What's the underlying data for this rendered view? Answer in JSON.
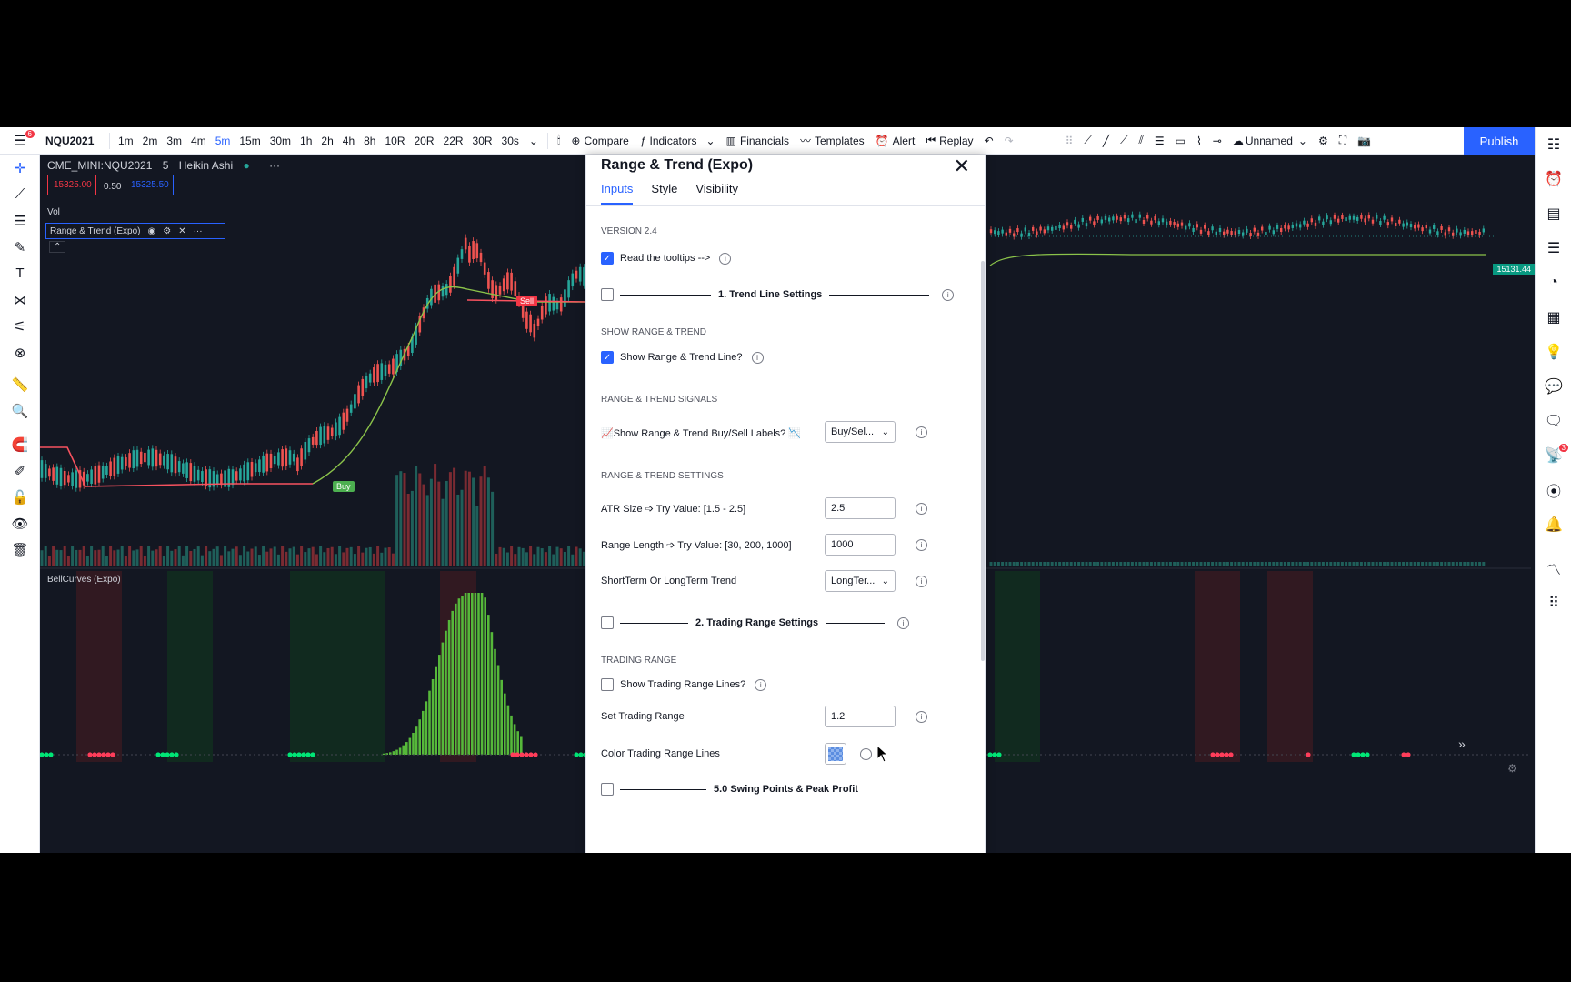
{
  "topbar": {
    "menu_badge": "6",
    "symbol": "NQU2021",
    "timeframes": [
      "1m",
      "2m",
      "3m",
      "4m",
      "5m",
      "15m",
      "30m",
      "1h",
      "2h",
      "4h",
      "8h",
      "10R",
      "20R",
      "22R",
      "30R",
      "30s"
    ],
    "active_timeframe": "5m",
    "compare": "Compare",
    "indicators": "Indicators",
    "financials": "Financials",
    "templates": "Templates",
    "alert": "Alert",
    "replay": "Replay",
    "layout_name": "Unnamed",
    "publish": "Publish"
  },
  "chart": {
    "symbol_line": "CME_MINI:NQU2021",
    "interval": "5",
    "chart_type": "Heikin Ashi",
    "bid": "15325.00",
    "spread": "0.50",
    "ask": "15325.50",
    "vol_label": "Vol",
    "indicator_name": "Range & Trend (Expo)",
    "lower_pane_name": "BellCurves (Expo)",
    "price_tag": "15131.44",
    "sell_label": "Sell",
    "buy_label": "Buy",
    "colors": {
      "up": "#26a69a",
      "down": "#ef5350",
      "trend": "#8bc34a",
      "range": "#f7525f",
      "accent": "#2962ff"
    }
  },
  "rightbar": {
    "notification_count": "3"
  },
  "dialog": {
    "title": "Range & Trend (Expo)",
    "tabs": [
      "Inputs",
      "Style",
      "Visibility"
    ],
    "version": "VERSION 2.4",
    "read_tooltips": "Read the tooltips -->",
    "trend_header": "1. Trend Line Settings",
    "show_range_trend_section": "SHOW RANGE & TREND",
    "show_range_trend_line": "Show Range & Trend Line?",
    "signals_section": "RANGE & TREND SIGNALS",
    "show_labels": "📈Show Range & Trend Buy/Sell Labels? 📉",
    "labels_value": "Buy/Sel...",
    "settings_section": "RANGE & TREND SETTINGS",
    "atr_label": "ATR Size ➩ Try Value: [1.5 - 2.5]",
    "atr_value": "2.5",
    "range_length_label": "Range Length ➩ Try Value: [30, 200, 1000]",
    "range_length_value": "1000",
    "trend_mode_label": "ShortTerm Or LongTerm Trend",
    "trend_mode_value": "LongTer...",
    "trading_header": "2. Trading Range Settings",
    "trading_range_section": "TRADING RANGE",
    "show_trading_lines": "Show Trading Range Lines?",
    "set_trading_range_label": "Set Trading Range",
    "set_trading_range_value": "1.2",
    "color_lines_label": "Color Trading Range Lines",
    "swing_header": "5.0 Swing Points & Peak Profit"
  }
}
